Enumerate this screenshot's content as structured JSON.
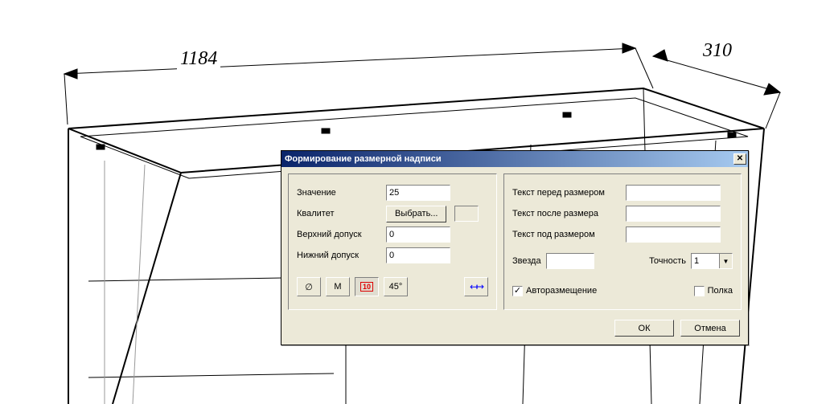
{
  "drawing": {
    "dim_top": "1184",
    "dim_right": "310"
  },
  "dialog": {
    "title": "Формирование размерной надписи",
    "left": {
      "value_label": "Значение",
      "value": "25",
      "qualitet_label": "Квалитет",
      "choose_btn": "Выбрать...",
      "upper_tol_label": "Верхний допуск",
      "upper_tol": "0",
      "lower_tol_label": "Нижний допуск",
      "lower_tol": "0",
      "tools": {
        "diameter": "∅",
        "metric": "М",
        "boxed": "10",
        "angle": "45°",
        "arrows": "↤↦"
      }
    },
    "right": {
      "text_before_label": "Текст перед размером",
      "text_before": "",
      "text_after_label": "Текст после размера",
      "text_after": "",
      "text_under_label": "Текст под размером",
      "text_under": "",
      "star_label": "Звезда",
      "star": "",
      "precision_label": "Точность",
      "precision": "1",
      "autoplacement_label": "Авторазмещение",
      "autoplacement_checked": true,
      "shelf_label": "Полка",
      "shelf_checked": false
    },
    "footer": {
      "ok": "ОК",
      "cancel": "Отмена"
    }
  }
}
